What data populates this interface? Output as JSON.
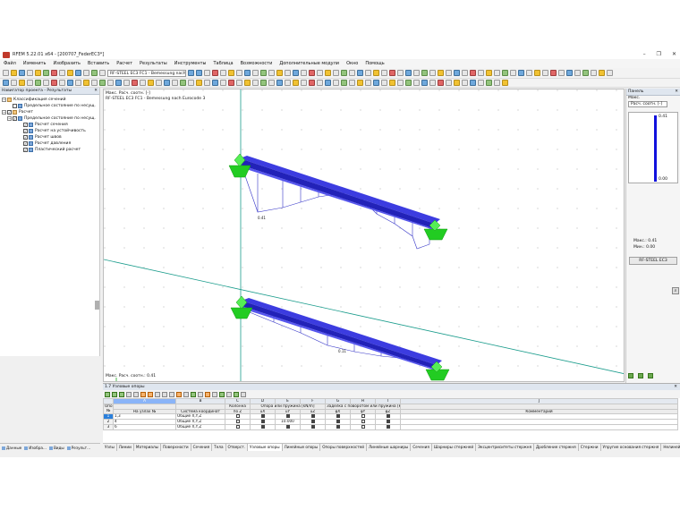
{
  "window": {
    "title": "RFEM 5.22.01 x64 - [200707_FederEC3*]"
  },
  "menu": [
    "Файл",
    "Изменить",
    "Изобразить",
    "Вставить",
    "Расчет",
    "Результаты",
    "Инструменты",
    "Таблица",
    "Возможности",
    "Дополнительные модули",
    "Окно",
    "Помощь"
  ],
  "toolbar": {
    "case_select": "RF-STEEL EC3 FC1 - Bemessung nach E"
  },
  "navigator": {
    "title": "Навигатор проекта - Результаты",
    "nodes": [
      {
        "label": "Классификация сечений"
      },
      {
        "label": "Предельное состояние по несущ."
      },
      {
        "label": "Расчет"
      },
      {
        "label": "Предельное состояние по несущ."
      },
      {
        "label": "Расчет сечения"
      },
      {
        "label": "Расчет на устойчивость"
      },
      {
        "label": "Расчет швов"
      },
      {
        "label": "Расчет давления"
      },
      {
        "label": "Пластический расчет"
      }
    ],
    "tabs": [
      "Данные",
      "Изобра...",
      "Виды",
      "Результ..."
    ]
  },
  "viewport": {
    "info_line1": "Макс. Расч. соотн. [-]",
    "info_line2": "RF-STEEL EC3 FC1 - Bemessung nach Eurocode 3",
    "footer": "Макс. Расч. соотн.: 0.41",
    "label_upper": "0.41",
    "label_lower": "0.11"
  },
  "panel": {
    "title": "Панель",
    "max_label": "Макс.",
    "combo_value": "Расч. соотн. [-]",
    "legend_max": "0.41",
    "legend_min": "0.00",
    "stat_max": "Макс.:   0.41",
    "stat_min": "Мин.:    0.00",
    "button": "RF-STEEL EC3"
  },
  "table": {
    "title": "1.7 Узловые опоры",
    "letters": [
      "",
      "A",
      "B",
      "C",
      "D",
      "E",
      "F",
      "G",
      "H",
      "I",
      "J"
    ],
    "group_headers": {
      "col1": "Опора №",
      "kolonna": "Колонна",
      "spring": "Опора или пружина [kN/m]",
      "restraint": "Заделка с поворотом или пружина [kNm/rad]"
    },
    "sub_headers": [
      "",
      "На узлах №",
      "Система координат",
      "по Z",
      "uX",
      "uY",
      "uZ",
      "φX",
      "φY",
      "φZ",
      "Комментарий"
    ],
    "rows": [
      {
        "no": "1",
        "nodes": "1,3",
        "system": "Общие X,Y,Z",
        "c": false,
        "ux": true,
        "uy": true,
        "uz": true,
        "fx": true,
        "fy": false,
        "fz": true
      },
      {
        "no": "2",
        "nodes": "4",
        "system": "Общие X,Y,Z",
        "c": false,
        "ux": true,
        "uy": "10.000",
        "uz": true,
        "fx": true,
        "fy": false,
        "fz": true
      },
      {
        "no": "3",
        "nodes": "6",
        "system": "Общие X,Y,Z",
        "c": false,
        "ux": true,
        "uy": true,
        "uz": true,
        "fx": true,
        "fy": false,
        "fz": true
      }
    ],
    "tabs": [
      "Узлы",
      "Линии",
      "Материалы",
      "Поверхности",
      "Сечения",
      "Тела",
      "Отверст.",
      "Узловые опоры",
      "Линейные опоры",
      "Опоры поверхностей",
      "Линейные шарниры",
      "Сечения",
      "Шарниры стержней",
      "Эксцентриситеты стержня",
      "Дробление стержня",
      "Стержни",
      "Упругие основания стержня",
      "Нелинейности стержня"
    ],
    "active_tab": "Узловые опоры"
  },
  "colors": {
    "beam": "#2b2bd6",
    "support": "#22cc22",
    "axis_line": "#1a9c8c",
    "legend": "#1111dd"
  }
}
